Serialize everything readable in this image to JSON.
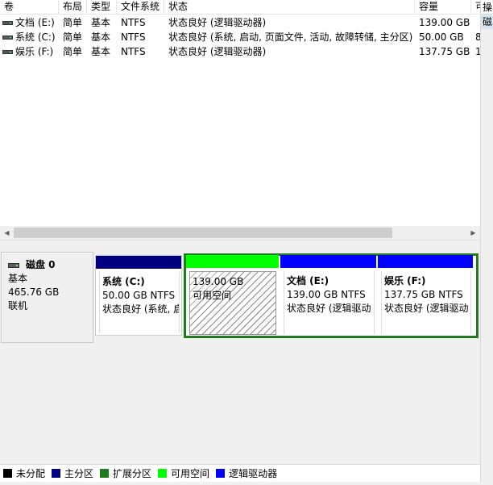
{
  "columns": [
    "卷",
    "布局",
    "类型",
    "文件系统",
    "状态",
    "容量",
    "可"
  ],
  "volumes": [
    {
      "name": "文档 (E:)",
      "layout": "简单",
      "type": "基本",
      "fs": "NTFS",
      "status": "状态良好 (逻辑驱动器)",
      "capacity": "139.00 GB",
      "extra": ""
    },
    {
      "name": "系统 (C:)",
      "layout": "简单",
      "type": "基本",
      "fs": "NTFS",
      "status": "状态良好 (系统, 启动, 页面文件, 活动, 故障转储, 主分区)",
      "capacity": "50.00 GB",
      "extra": "8"
    },
    {
      "name": "娱乐 (F:)",
      "layout": "简单",
      "type": "基本",
      "fs": "NTFS",
      "status": "状态良好 (逻辑驱动器)",
      "capacity": "137.75 GB",
      "extra": "1"
    }
  ],
  "disk": {
    "title": "磁盘 0",
    "type": "基本",
    "size": "465.76 GB",
    "state": "联机"
  },
  "partitions": {
    "c": {
      "label": "系统  (C:)",
      "size": "50.00 GB NTFS",
      "status": "状态良好 (系统, 启"
    },
    "free": {
      "size": "139.00 GB",
      "status": "可用空间"
    },
    "e": {
      "label": "文档  (E:)",
      "size": "139.00 GB NTFS",
      "status": "状态良好 (逻辑驱动"
    },
    "f": {
      "label": "娱乐  (F:)",
      "size": "137.75 GB NTFS",
      "status": "状态良好 (逻辑驱动"
    }
  },
  "right_panel": {
    "header": "操",
    "selected": "磁"
  },
  "legend": [
    {
      "label": "未分配",
      "color": "#000000"
    },
    {
      "label": "主分区",
      "color": "#000080"
    },
    {
      "label": "扩展分区",
      "color": "#1e7b1e"
    },
    {
      "label": "可用空间",
      "color": "#00ff00"
    },
    {
      "label": "逻辑驱动器",
      "color": "#0000ff"
    }
  ],
  "colors": {
    "primary": "#000080",
    "extended": "#1e7b1e",
    "free": "#00ff00",
    "logical": "#0000ff"
  }
}
